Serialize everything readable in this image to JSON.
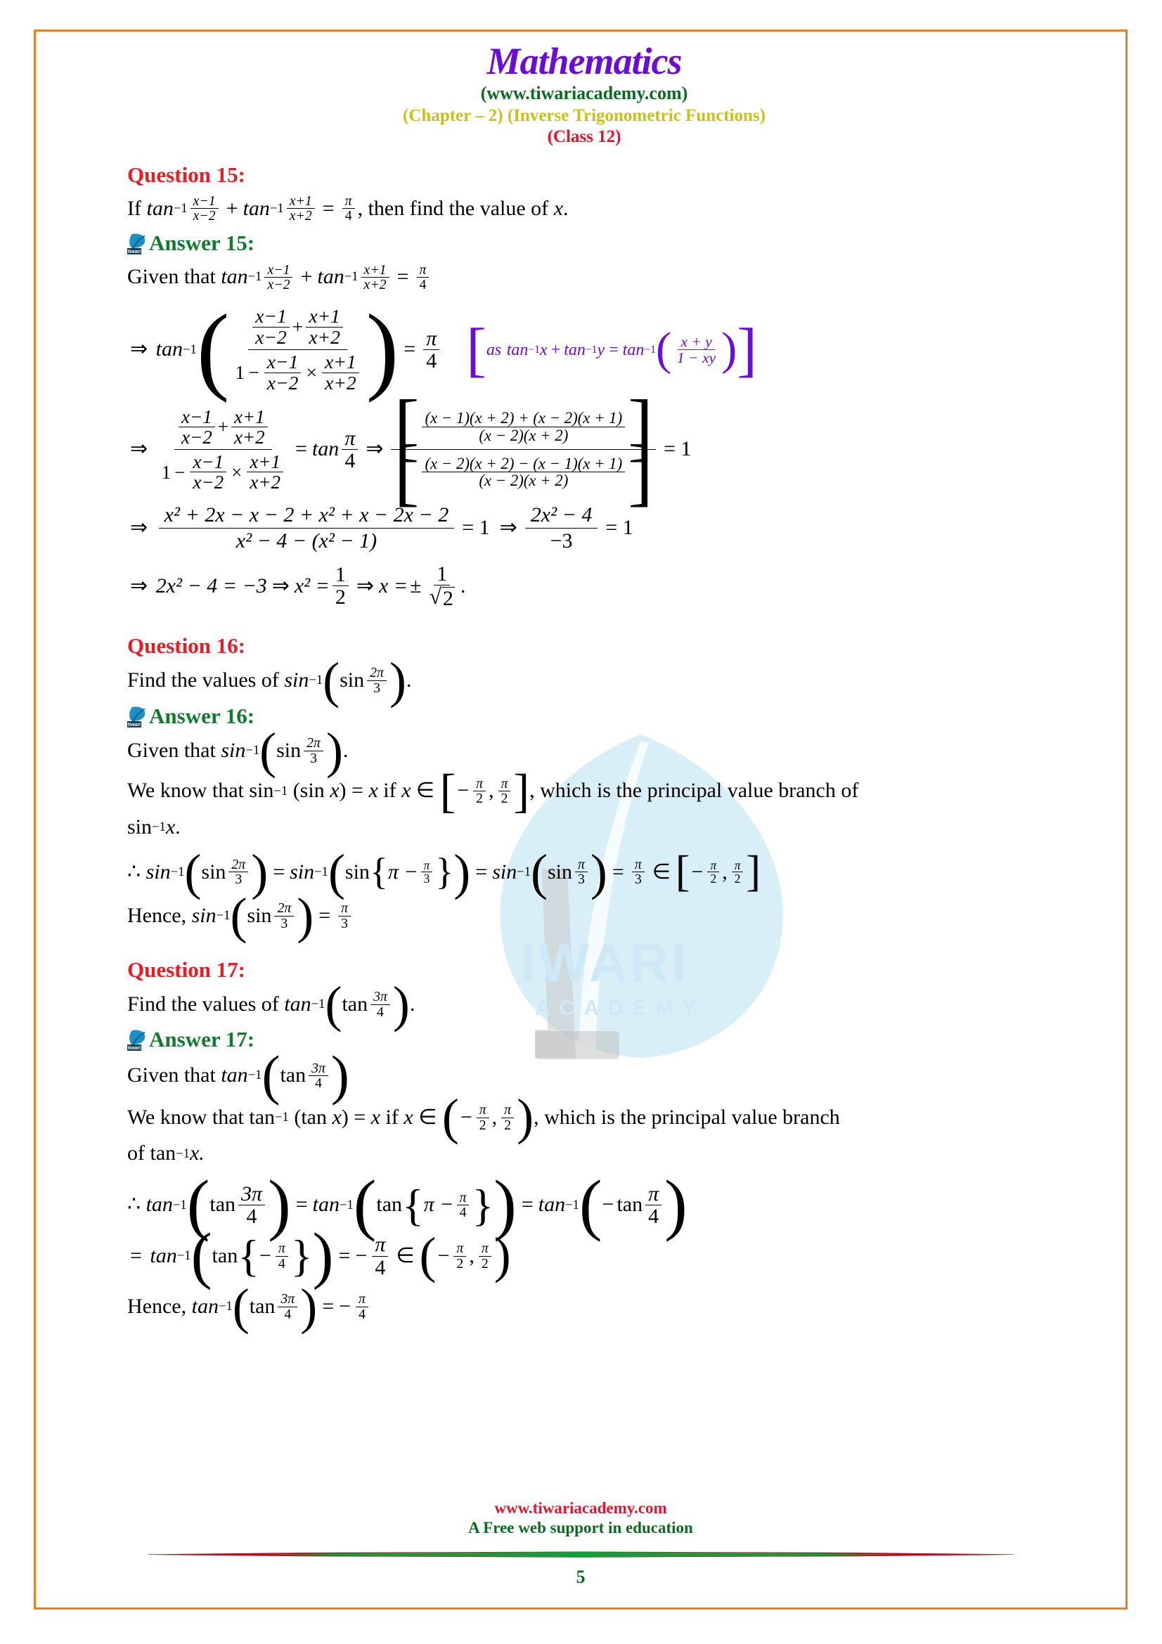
{
  "header": {
    "title": "Mathematics",
    "site": "(www.tiwariacademy.com)",
    "chapter": "(Chapter – 2) (Inverse Trigonometric Functions)",
    "class": "(Class 12)",
    "colors": {
      "title": "#6A0DD6",
      "site": "#0A6B1E",
      "chapter": "#C8C218",
      "class": "#E8132B",
      "border": "#F07D22"
    }
  },
  "watermark": {
    "line1": "IWARI",
    "line2": "ACADEMY",
    "color": "#cfe8f5"
  },
  "q15": {
    "question_heading": "Question 15:",
    "answer_heading": "Answer 15:",
    "q_prefix": "If",
    "q_suffix": ", then find the value of",
    "q_var": "x",
    "q_dot": ".",
    "given_label": "Given that",
    "tan": "tan",
    "inv": "−1",
    "num1": "x−1",
    "den1": "x−2",
    "num2": "x+1",
    "den2": "x+2",
    "pi": "π",
    "four": "4",
    "plus": "+",
    "equals": "=",
    "times": "×",
    "minus": "−",
    "arrow": "⇒",
    "one": "1",
    "note_as": "as",
    "note_x": "x",
    "note_y": "y",
    "note_num": "x + y",
    "note_den": "1 − xy",
    "bn1": "(x − 1)(x + 2) + (x − 2)(x + 1)",
    "bd1": "(x − 2)(x + 2)",
    "bn2": "(x − 2)(x + 2) − (x − 1)(x + 1)",
    "bd2": "(x − 2)(x + 2)",
    "eq_one": "= 1",
    "l5_num": "x² + 2x − x − 2 + x² + x − 2x − 2",
    "l5_den": "x² − 4 − (x² − 1)",
    "l5_eq": "= 1",
    "l5b_num": "2x² − 4",
    "l5b_den": "−3",
    "l5b_eq": "= 1",
    "l6_a": "2x² − 4 = −3",
    "l6_b": "x² =",
    "l6_c": "x =",
    "l6_half_n": "1",
    "l6_half_d": "2",
    "l6_pm": "±",
    "l6_root_n": "1",
    "l6_root_d": "2",
    "period": "."
  },
  "q16": {
    "question_heading": "Question 16:",
    "answer_heading": "Answer 16:",
    "find": "Find the values of",
    "sin": "sin",
    "sin_l": "sin",
    "inv": "−1",
    "twopi": "2π",
    "three": "3",
    "dot": ".",
    "given_label": "Given that",
    "know_1": "We know that sin",
    "know_2": "(sin",
    "know_3": ") =",
    "know_4": "if",
    "know_5": "∈",
    "know_6": ", which is the principal value branch of",
    "x": "x",
    "pi": "π",
    "two": "2",
    "sin_inv_x": "sin",
    "therefore": "∴",
    "pi_minus": "π −",
    "equals": "=",
    "in_sym": "∈",
    "hence": "Hence,",
    "period": "."
  },
  "q17": {
    "question_heading": "Question 17:",
    "answer_heading": "Answer 17:",
    "find": "Find the values of",
    "tan": "tan",
    "tan_l": "tan",
    "inv": "−1",
    "threepi": "3π",
    "four": "4",
    "dot": ".",
    "given_label": "Given that",
    "know_1": "We know that tan",
    "know_2": "(tan",
    "know_3": ") =",
    "know_4": "if",
    "know_5": "∈",
    "know_6": ", which is the principal value branch",
    "know_7": "of tan",
    "know_8": "x.",
    "x": "x",
    "pi": "π",
    "two": "2",
    "therefore": "∴",
    "pi_minus": "π −",
    "equals": "=",
    "minus": "−",
    "in_sym": "∈",
    "hence": "Hence,",
    "neg": "−"
  },
  "footer": {
    "url": "www.tiwariacademy.com",
    "tagline": "A Free web support in education",
    "page_number": "5",
    "url_color": "#E8132B",
    "tagline_color": "#0A6B1E"
  }
}
